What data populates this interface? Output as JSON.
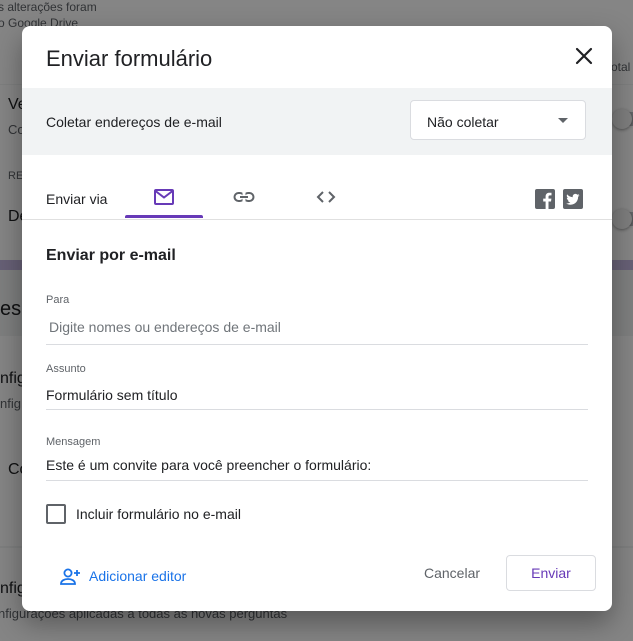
{
  "background": {
    "saved_line1": "s alterações foram",
    "saved_line2": "o Google Drive",
    "right_fragment": "otal",
    "row1_title": "Ve",
    "row1_sub": "Co",
    "section_label": "RE",
    "row2_title": "De",
    "section2": "es",
    "config_title": "nfig",
    "config_sub": "nfig",
    "co_row": "Co",
    "bottom_title": "nfig",
    "bottom_sub": "nfigurações aplicadas a todas as novas perguntas"
  },
  "dialog": {
    "title": "Enviar formulário",
    "collect": {
      "label": "Coletar endereços de e-mail",
      "selected": "Não coletar"
    },
    "send_via_label": "Enviar via",
    "tabs": [
      {
        "icon": "email-icon",
        "active": true
      },
      {
        "icon": "link-icon",
        "active": false
      },
      {
        "icon": "embed-code-icon",
        "active": false
      }
    ],
    "social": [
      "facebook-icon",
      "twitter-icon"
    ],
    "section_title": "Enviar por e-mail",
    "to": {
      "label": "Para",
      "placeholder": "Digite nomes ou endereços de e-mail"
    },
    "subject": {
      "label": "Assunto",
      "value": "Formulário sem título"
    },
    "message": {
      "label": "Mensagem",
      "value": "Este é um convite para você preencher o formulário:"
    },
    "include_form": {
      "label": "Incluir formulário no e-mail",
      "checked": false
    },
    "add_editor": "Adicionar editor",
    "cancel": "Cancelar",
    "send": "Enviar"
  },
  "colors": {
    "accent": "#673ab7",
    "link": "#1a73e8"
  }
}
